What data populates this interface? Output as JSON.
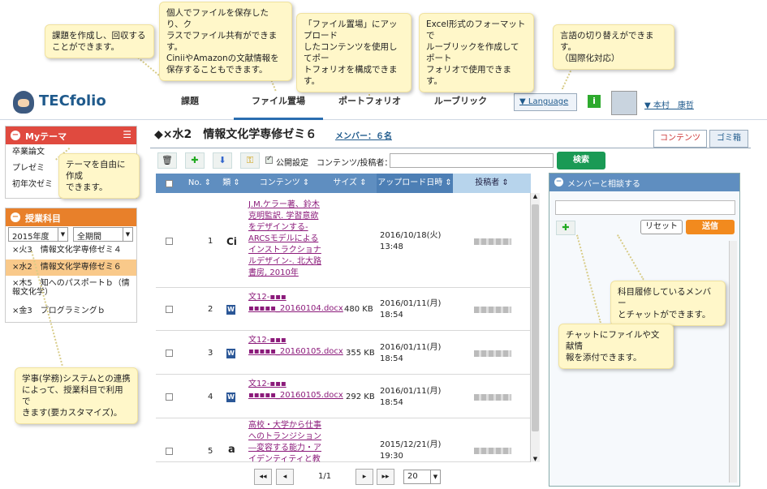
{
  "callouts": [
    {
      "id": "c1",
      "text": "課題を作成し、回収する\nことができます。"
    },
    {
      "id": "c2",
      "text": "個人でファイルを保存したり、ク\nラスでファイル共有ができます。\nCiniiやAmazonの文献情報を\n保存することもできます。"
    },
    {
      "id": "c3",
      "text": "「ファイル置場」にアップロード\nしたコンテンツを使用してポー\nトフォリオを構成できます。"
    },
    {
      "id": "c4",
      "text": "Excel形式のフォーマットで\nルーブリックを作成してポート\nフォリオで使用できます。"
    },
    {
      "id": "c5",
      "text": "言語の切り替えができます。\n（国際化対応）"
    },
    {
      "id": "c6",
      "text": "テーマを自由に作成\nできます。"
    },
    {
      "id": "c7",
      "text": "学事(学務)システムとの連携\nによって、授業科目で利用で\nきます(要カスタマイズ)。"
    },
    {
      "id": "c8",
      "text": "科目履修しているメンバー\nとチャットができます。"
    },
    {
      "id": "c9",
      "text": "チャットにファイルや文献情\n報を添付できます。"
    }
  ],
  "header": {
    "logo": "TECfolio",
    "nav": [
      "課題",
      "ファイル置場",
      "ポートフォリオ",
      "ルーブリック"
    ],
    "language": "▼ Language",
    "info": "i",
    "user": "▼ 本村　康哲"
  },
  "my_theme": {
    "title": "Myテーマ",
    "items": [
      "卒業論文",
      "プレゼミ",
      "初年次ゼミ"
    ]
  },
  "courses": {
    "title": "授業科目",
    "year": "2015年度",
    "term": "全期間",
    "items": [
      "×火3　情報文化学専修ゼミ４",
      "×水2　情報文化学専修ゼミ６",
      "×木5　知へのパスポートｂ（情報文化学）",
      "×金3　プログラミングｂ"
    ],
    "active_index": 1
  },
  "main": {
    "title": "◆×水2　情報文化学専修ゼミ６",
    "members": "メンバー：６名",
    "tabs": [
      "コンテンツ",
      "ゴミ箱"
    ],
    "public_setting": "公開設定",
    "search_label": "コンテンツ/投稿者：",
    "search_button": "検索",
    "columns": [
      "No.",
      "類",
      "コンテンツ",
      "サイズ",
      "アップロード日時",
      "投稿者"
    ],
    "rows": [
      {
        "no": "1",
        "type": "Ci",
        "content": "J.M.ケラー著、鈴木克明監訳. 学習意欲をデザインする-ARCSモデルによるインストラクショナルデザイン-. 北大路書房, 2010年",
        "size": "",
        "date": "2016/10/18(火) 13:48"
      },
      {
        "no": "2",
        "type": "W",
        "content": "文12-▪▪▪ ▪▪▪▪▪_20160104.docx",
        "size": "480 KB",
        "date": "2016/01/11(月) 18:54"
      },
      {
        "no": "3",
        "type": "W",
        "content": "文12-▪▪▪ ▪▪▪▪▪_20160105.docx",
        "size": "355 KB",
        "date": "2016/01/11(月) 18:54"
      },
      {
        "no": "4",
        "type": "W",
        "content": "文12-▪▪▪ ▪▪▪▪▪_20160105.docx",
        "size": "292 KB",
        "date": "2016/01/11(月) 18:54"
      },
      {
        "no": "5",
        "type": "a",
        "content": "高校・大学から仕事へのトランジション―変容する能力・アイデンティティと教",
        "size": "",
        "date": "2015/12/21(月) 19:30"
      }
    ],
    "pager": {
      "first": "◂◂",
      "prev": "◂",
      "page": "1/1",
      "next": "▸",
      "last": "▸▸",
      "per_page": "20"
    }
  },
  "chat": {
    "title": "メンバーと相談する",
    "reset": "リセット",
    "send": "送信"
  },
  "colors": {
    "red": "#e04a3f",
    "orange": "#e8802a",
    "blue": "#5f8ec0",
    "green": "#1a9a55"
  }
}
